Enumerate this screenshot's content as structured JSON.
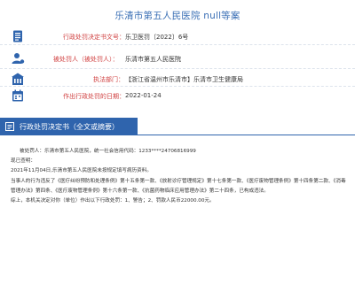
{
  "page": {
    "title": "乐清市第五人民医院 null等案"
  },
  "info": [
    {
      "icon": "document-icon",
      "label": "行政处罚决定书文号：",
      "value": "乐卫医罚〔2022〕6号"
    },
    {
      "icon": "user-icon",
      "label": "被处罚人（被处罚人）：",
      "value": "乐清市第五人民医院"
    },
    {
      "icon": "building-icon",
      "label": "执法部门：",
      "value": "【浙江省温州市乐清市】乐清市卫生健康局"
    },
    {
      "icon": "calendar-icon",
      "label": "作出行政处罚的日期：",
      "value": "2022-01-24"
    }
  ],
  "section": {
    "icon": "note-icon",
    "title": "行政处罚决定书（全文或摘要）"
  },
  "content": {
    "para1": "被处罚人：乐清市第五人民医院，统一社会信用代码：1233****24706816999",
    "para2": "现已查明：",
    "para3": "2021年11月04日,乐清市第五人民医院未按规定填写病历资料。",
    "para4": "当事人的行为违反了《医疗纠纷预防和处理条例》第十五条第一款、《放射诊疗管理规定》第十七条第一款、《医疗废物管理条例》第十四条第二款、《消毒管理办法》第四条、《医疗废物管理条例》第十六条第一款、《抗菌药物临床应用管理办法》第二十四条，已构成违法。",
    "para5": "综上，本机关决定对你（单位）作出以下行政处罚：1、警告；2、罚款人民币22000.00元。"
  },
  "colors": {
    "title": "#3a6fb5",
    "label": "#d04040",
    "section_bg": "#2f64ad"
  }
}
